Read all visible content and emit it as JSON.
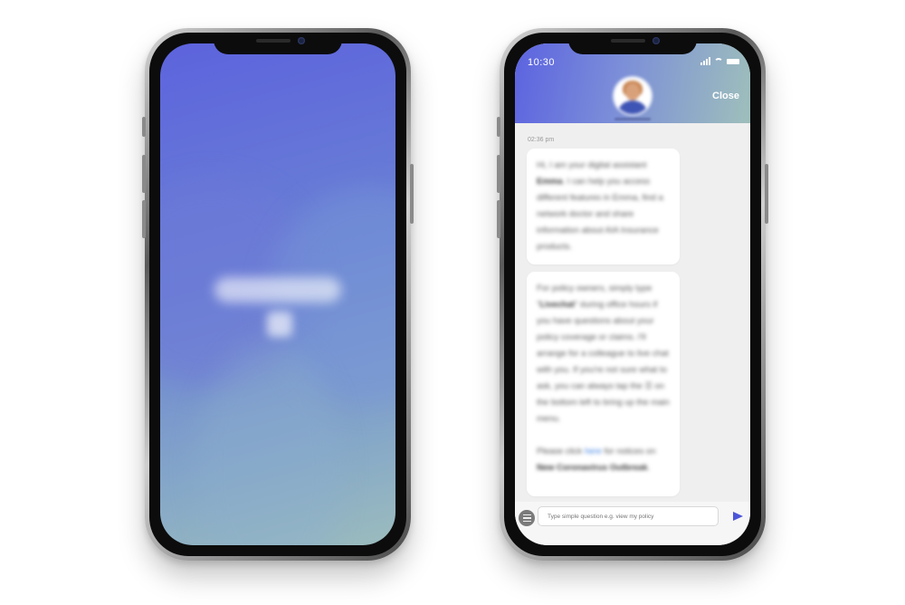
{
  "splash": {
    "gradient_start": "#5d63dd",
    "gradient_end": "#9bbcbd"
  },
  "chat": {
    "status_time": "10:30",
    "close_label": "Close",
    "message_time": "02:36 pm",
    "messages": [
      {
        "intro": "Hi, I am your digital assistant ",
        "name": "Emma",
        "rest": ". I can help you access different features in Emma, find a network doctor and share information about AIA Insurance products."
      },
      {
        "intro": "For policy owners, simply type \"",
        "keyword": "Livechat",
        "mid": "\" during office hours if you have questions about your policy coverage or claims. I'll arrange for a colleague to live chat with you. If you're not sure what to ask, you can always tap the ",
        "menu": "☰",
        "end": " on the bottom left to bring up the main menu.",
        "notice_prefix": "Please click ",
        "notice_link": "here",
        "notice_mid": " for notices on ",
        "notice_bold": "New Coronavirus Outbreak",
        "notice_end": "."
      }
    ],
    "input_placeholder": "Type simple question e.g. view my policy",
    "accent_color": "#4b55d8"
  }
}
